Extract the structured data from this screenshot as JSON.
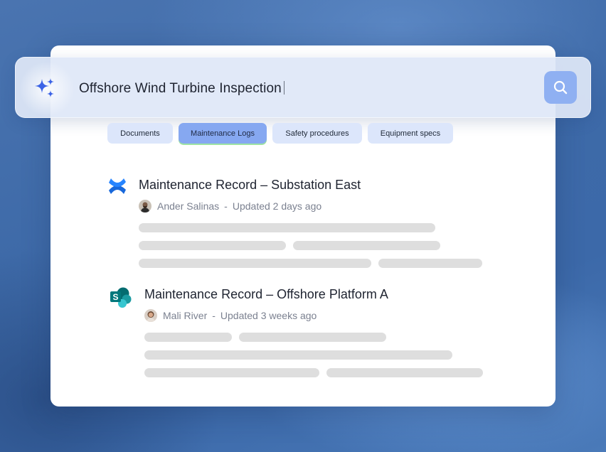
{
  "search": {
    "query": "Offshore Wind Turbine Inspection",
    "ai_icon": "sparkle-icon",
    "button_icon": "search-icon",
    "accent_color": "#8fb0f2"
  },
  "filters": [
    {
      "label": "Documents",
      "active": false
    },
    {
      "label": "Maintenance Logs",
      "active": true
    },
    {
      "label": "Safety procedures",
      "active": false
    },
    {
      "label": "Equipment specs",
      "active": false
    }
  ],
  "results": [
    {
      "source_icon": "confluence-icon",
      "title": "Maintenance Record – Substation East",
      "author": "Ander Salinas",
      "separator": "-",
      "updated": "Updated 2 days ago"
    },
    {
      "source_icon": "sharepoint-icon",
      "title": "Maintenance Record – Offshore Platform A",
      "author": "Mali River",
      "separator": "-",
      "updated": "Updated 3 weeks ago"
    }
  ]
}
